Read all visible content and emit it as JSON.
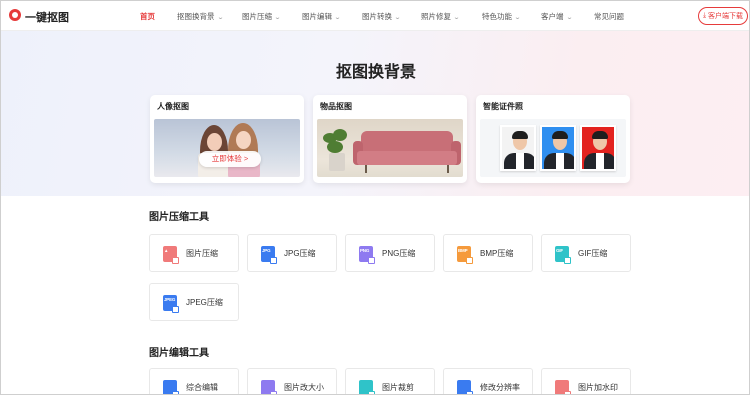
{
  "brand": {
    "name": "一键抠图"
  },
  "nav": {
    "items": [
      {
        "label": "首页",
        "active": true
      },
      {
        "label": "抠图换背景",
        "dropdown": true
      },
      {
        "label": "图片压缩",
        "dropdown": true
      },
      {
        "label": "图片编辑",
        "dropdown": true
      },
      {
        "label": "图片转换",
        "dropdown": true
      },
      {
        "label": "照片修复",
        "dropdown": true
      },
      {
        "label": "特色功能",
        "dropdown": true
      },
      {
        "label": "客户端",
        "dropdown": true
      },
      {
        "label": "常见问题",
        "dropdown": false
      }
    ],
    "download_label": "客户端下载"
  },
  "hero": {
    "title": "抠图换背景",
    "cards": [
      {
        "title": "人像抠图",
        "button": "立即体验 >"
      },
      {
        "title": "物品抠图"
      },
      {
        "title": "智能证件照"
      }
    ]
  },
  "compress": {
    "title": "图片压缩工具",
    "tools": [
      {
        "label": "图片压缩",
        "icon": "image-compress-icon",
        "badge": "",
        "color": "#f07a7a"
      },
      {
        "label": "JPG压缩",
        "icon": "jpg-file-icon",
        "badge": "JPG",
        "color": "#3a7bf0"
      },
      {
        "label": "PNG压缩",
        "icon": "png-file-icon",
        "badge": "PNG",
        "color": "#8e7af0"
      },
      {
        "label": "BMP压缩",
        "icon": "bmp-file-icon",
        "badge": "BMP",
        "color": "#f59a3c"
      },
      {
        "label": "GIF压缩",
        "icon": "gif-file-icon",
        "badge": "GIF",
        "color": "#2fc3c9"
      },
      {
        "label": "JPEG压缩",
        "icon": "jpeg-file-icon",
        "badge": "JPEG",
        "color": "#3a7bf0"
      }
    ]
  },
  "edit": {
    "title": "图片编辑工具",
    "tools": [
      {
        "label": "综合编辑",
        "icon": "image-edit-icon",
        "color": "#3a7bf0"
      },
      {
        "label": "图片改大小",
        "icon": "resize-icon",
        "color": "#8e7af0"
      },
      {
        "label": "图片裁剪",
        "icon": "crop-icon",
        "color": "#2fc3c9"
      },
      {
        "label": "修改分辨率",
        "icon": "resolution-icon",
        "color": "#3a7bf0"
      },
      {
        "label": "图片加水印",
        "icon": "watermark-icon",
        "color": "#f07a7a"
      }
    ]
  },
  "colors": {
    "accent": "#e63b3b"
  }
}
